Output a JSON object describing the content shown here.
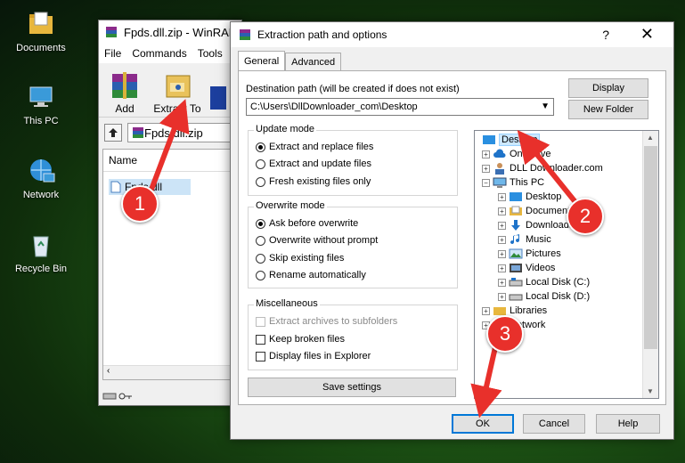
{
  "desktop": {
    "icons": [
      {
        "label": "Documents",
        "icon": "folder-icon"
      },
      {
        "label": "This PC",
        "icon": "computer-icon"
      },
      {
        "label": "Network",
        "icon": "network-icon"
      },
      {
        "label": "Recycle Bin",
        "icon": "recycle-bin-icon"
      }
    ]
  },
  "winrar": {
    "title": "Fpds.dll.zip - WinRAR",
    "menu": [
      "File",
      "Commands",
      "Tools"
    ],
    "toolbar": {
      "add_label": "Add",
      "extract_label": "Extract To"
    },
    "address": "Fpds.dll.zip",
    "list_header": "Name",
    "file": "Fpds.dll"
  },
  "dialog": {
    "title": "Extraction path and options",
    "help_glyph": "?",
    "close_glyph": "✕",
    "tabs": [
      "General",
      "Advanced"
    ],
    "dest_label": "Destination path (will be created if does not exist)",
    "dest_value": "C:\\Users\\DllDownloader_com\\Desktop",
    "display_btn": "Display",
    "new_folder_btn": "New Folder",
    "update_mode": {
      "title": "Update mode",
      "options": [
        "Extract and replace files",
        "Extract and update files",
        "Fresh existing files only"
      ],
      "selected": 0
    },
    "overwrite_mode": {
      "title": "Overwrite mode",
      "options": [
        "Ask before overwrite",
        "Overwrite without prompt",
        "Skip existing files",
        "Rename automatically"
      ],
      "selected": 0
    },
    "misc": {
      "title": "Miscellaneous",
      "options": [
        "Extract archives to subfolders",
        "Keep broken files",
        "Display files in Explorer"
      ]
    },
    "save_btn": "Save settings",
    "tree": [
      "Desktop",
      "OneDrive",
      "DLL Downloader.com",
      "This PC",
      "Desktop",
      "Documents",
      "Downloads",
      "Music",
      "Pictures",
      "Videos",
      "Local Disk (C:)",
      "Local Disk (D:)",
      "Libraries",
      "Network"
    ],
    "ok_btn": "OK",
    "cancel_btn": "Cancel",
    "help_btn": "Help"
  },
  "callouts": [
    "1",
    "2",
    "3"
  ],
  "colors": {
    "callout_red": "#e8302b",
    "selection": "#cce8ff",
    "accent": "#0078d7"
  }
}
